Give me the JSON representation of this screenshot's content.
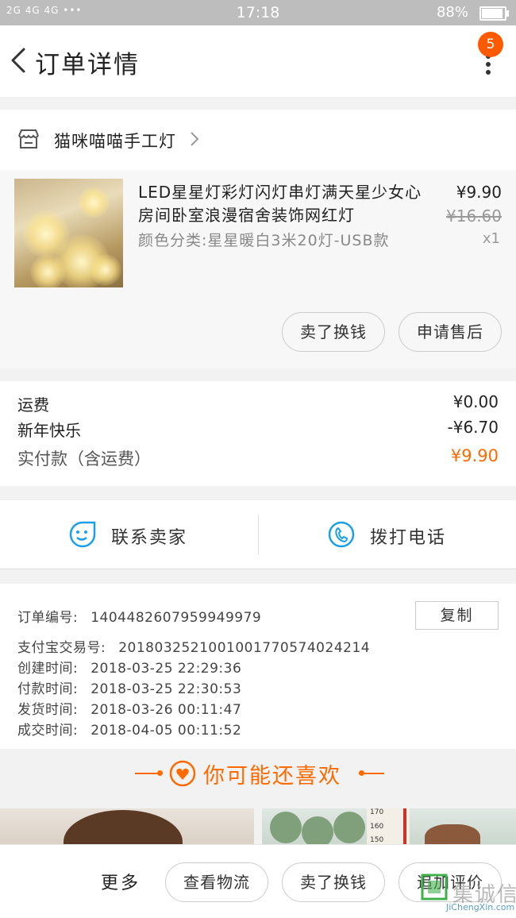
{
  "status_bar": {
    "signal": "2G 4G 4G •••",
    "time": "17:18",
    "battery": "88%",
    "battery_level": 0.88
  },
  "header": {
    "title": "订单详情",
    "badge_count": "5"
  },
  "shop": {
    "name": "猫咪喵喵手工灯"
  },
  "product": {
    "name": "LED星星灯彩灯闪灯串灯满天星少女心房间卧室浪漫宿舍装饰网红灯",
    "sku": "颜色分类:星星暖白3米20灯-USB款",
    "price": "¥9.90",
    "original_price": "¥16.60",
    "quantity": "x1",
    "sell_button": "卖了换钱",
    "aftersale_button": "申请售后"
  },
  "fees": {
    "shipping_label": "运费",
    "shipping_value": "¥0.00",
    "discount_label": "新年快乐",
    "discount_value": "-¥6.70",
    "total_label": "实付款（含运费）",
    "total_value": "¥9.90"
  },
  "contact": {
    "seller_label": "联系卖家",
    "phone_label": "拨打电话"
  },
  "order_info": {
    "order_no_label": "订单编号:",
    "order_no": "1404482607959949979",
    "alipay_label": "支付宝交易号:",
    "alipay_no": "2018032521001001770574024214",
    "created_label": "创建时间:",
    "created": "2018-03-25 22:29:36",
    "paid_label": "付款时间:",
    "paid": "2018-03-25 22:30:53",
    "shipped_label": "发货时间:",
    "shipped": "2018-03-26 00:11:47",
    "closed_label": "成交时间:",
    "closed": "2018-04-05 00:11:52",
    "copy_button": "复制"
  },
  "recommend": {
    "title": "你可能还喜欢"
  },
  "recommend_images": {
    "ruler_ticks": [
      "170",
      "160",
      "150"
    ]
  },
  "bottom_bar": {
    "more": "更多",
    "logistics_button": "查看物流",
    "sell_button": "卖了换钱",
    "review_button": "追加评价"
  },
  "watermark": {
    "cn": "集诚信",
    "en": "JiChengXin.com"
  },
  "colors": {
    "accent": "#ff6a00",
    "badge": "#ff5a00",
    "icon_blue": "#1aa0e8"
  },
  "icons": {
    "back": "chevron-left-icon",
    "more": "more-vertical-icon",
    "shop": "store-icon",
    "chevron": "chevron-right-icon",
    "seller": "chat-smile-icon",
    "phone": "phone-icon",
    "heart": "heart-icon"
  }
}
